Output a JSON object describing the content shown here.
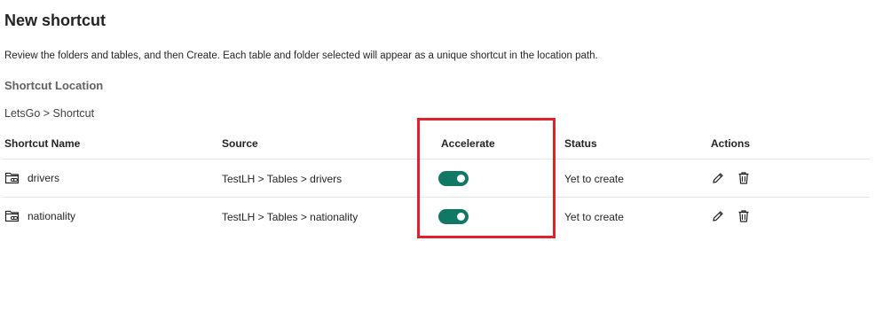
{
  "page": {
    "title": "New shortcut",
    "description": "Review the folders and tables, and then Create. Each table and folder selected will appear as a unique shortcut in the location path.",
    "location_label": "Shortcut Location",
    "location_path": "LetsGo > Shortcut"
  },
  "table": {
    "headers": {
      "name": "Shortcut Name",
      "source": "Source",
      "accelerate": "Accelerate",
      "status": "Status",
      "actions": "Actions"
    },
    "rows": [
      {
        "name": "drivers",
        "source": "TestLH > Tables > drivers",
        "accelerate": true,
        "status": "Yet to create",
        "icon": "folder-link-icon"
      },
      {
        "name": "nationality",
        "source": "TestLH > Tables > nationality",
        "accelerate": true,
        "status": "Yet to create",
        "icon": "folder-link-icon"
      }
    ]
  },
  "colors": {
    "toggle_on": "#117865",
    "highlight": "#e0202a"
  }
}
